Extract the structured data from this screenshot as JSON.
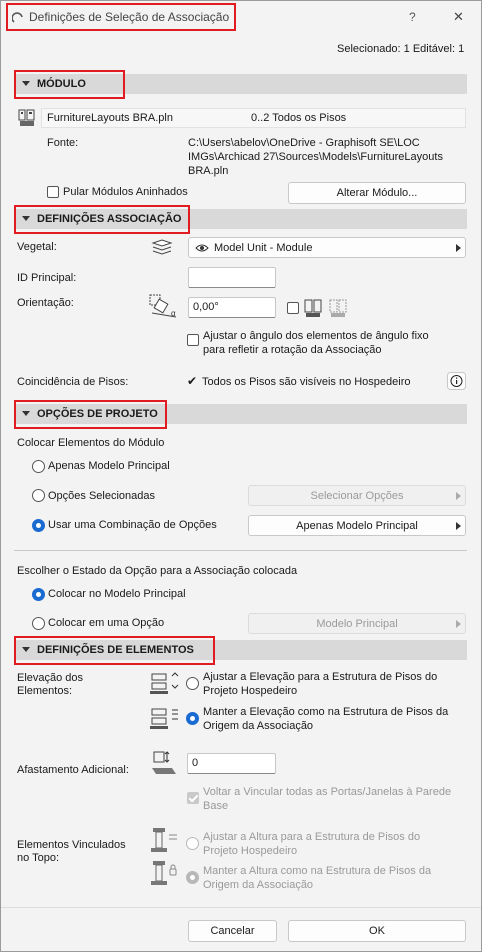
{
  "window": {
    "title": "Definições de Seleção de Associação",
    "help": "?",
    "close": "✕"
  },
  "status": {
    "selected_info": "Selecionado: 1 Editável: 1"
  },
  "module_section": {
    "title": "MÓDULO",
    "file_name": "FurnitureLayouts BRA.pln",
    "floors": "0..2 Todos os Pisos",
    "source_label": "Fonte:",
    "source_path_1": "C:\\Users\\abelov\\OneDrive - Graphisoft SE\\LOC",
    "source_path_2": "IMGs\\Archicad 27\\Sources\\Models\\FurnitureLayouts",
    "source_path_3": "BRA.pln",
    "skip_nested_label": "Pular Módulos Aninhados",
    "change_module_button": "Alterar Módulo..."
  },
  "hotlink_section": {
    "title": "DEFINIÇÕES ASSOCIAÇÃO",
    "layer_label": "Vegetal:",
    "layer_value": "Model Unit - Module",
    "master_id_label": "ID Principal:",
    "master_id_value": "",
    "orientation_label": "Orientação:",
    "orientation_value": "0,00°",
    "adjust_angle_label_1": "Ajustar o ângulo dos elementos de ângulo fixo",
    "adjust_angle_label_2": "para refletir a rotação da Associação",
    "story_match_label": "Coincidência de Pisos:",
    "story_match_value": "Todos os Pisos são visíveis no Hospedeiro"
  },
  "design_options_section": {
    "title": "OPÇÕES DE PROJETO",
    "place_elements_label": "Colocar Elementos do Módulo",
    "opt_main_only": "Apenas Modelo Principal",
    "opt_selected": "Opções Selecionadas",
    "select_options_button": "Selecionar Opções",
    "opt_combination": "Usar uma Combinação de Opções",
    "combination_value": "Apenas Modelo Principal",
    "choose_state_label": "Escolher o Estado da Opção para a Associação colocada",
    "place_main_model": "Colocar no Modelo Principal",
    "place_in_option": "Colocar em uma Opção",
    "option_value": "Modelo Principal"
  },
  "element_section": {
    "title": "DEFINIÇÕES DE ELEMENTOS",
    "elevation_label_1": "Elevação dos",
    "elevation_label_2": "Elementos:",
    "elev_adjust_1": "Ajustar a Elevação para a Estrutura de Pisos do",
    "elev_adjust_2": "Projeto Hospedeiro",
    "elev_keep_1": "Manter a Elevação como na Estrutura de Pisos da",
    "elev_keep_2": "Origem da Associação",
    "offset_label": "Afastamento Adicional:",
    "offset_value": "0",
    "relink_1": "Voltar a Vincular todas as Portas/Janelas à Parede",
    "relink_2": "Base",
    "top_linked_label_1": "Elementos Vinculados",
    "top_linked_label_2": "no Topo:",
    "top_adjust_1": "Ajustar a Altura para a Estrutura de Pisos do",
    "top_adjust_2": "Projeto Hospedeiro",
    "top_keep_1": "Manter a Altura como na Estrutura de Pisos da",
    "top_keep_2": "Origem da Associação"
  },
  "footer": {
    "cancel": "Cancelar",
    "ok": "OK"
  },
  "colors": {
    "accent": "#1a6bd1",
    "highlight_box": "#e11b22",
    "section_bg": "#d9d9d9"
  }
}
